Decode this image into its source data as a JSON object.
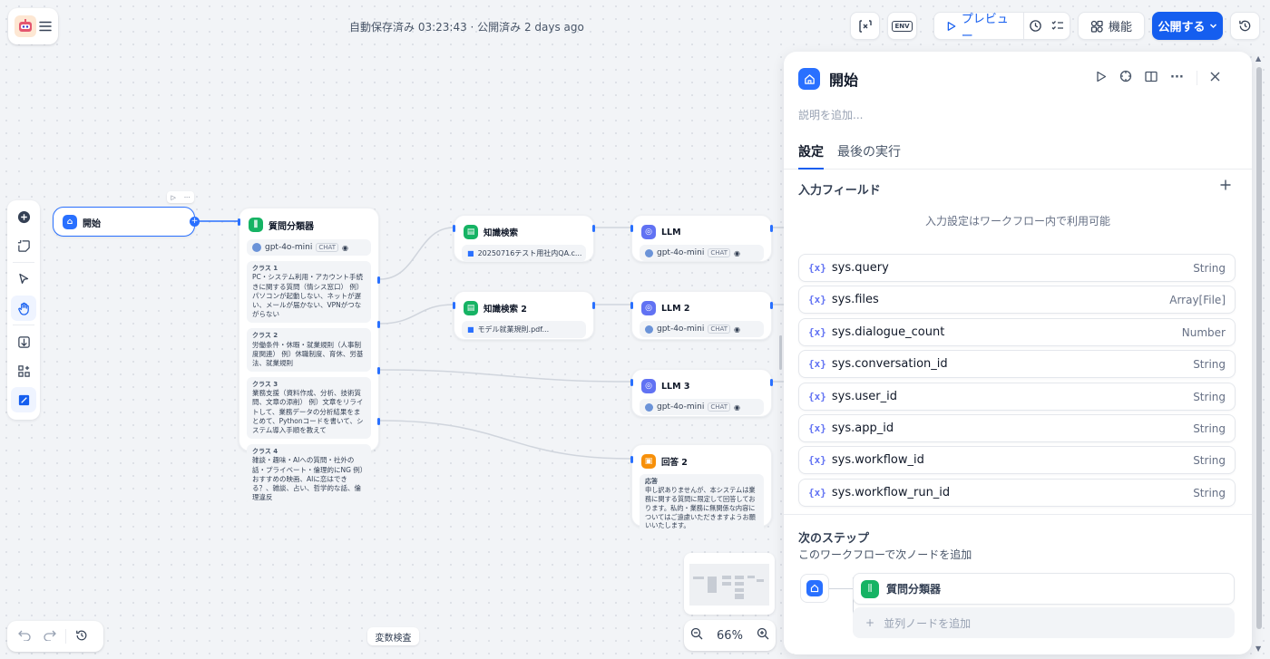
{
  "header": {
    "status_text": "自動保存済み 03:23:43 · 公開済み 2 days ago",
    "env_label": "ENV",
    "preview_label": "プレビュー",
    "features_label": "機能",
    "publish_label": "公開する"
  },
  "canvas": {
    "nodes": {
      "start": {
        "title": "開始"
      },
      "classifier": {
        "title": "質問分類器",
        "model": "gpt-4o-mini",
        "model_tag": "CHAT",
        "classes": [
          {
            "label": "クラス 1",
            "text": "PC・システム利用・アカウント手続きに関する質問（情シス窓口） 例）パソコンが起動しない、ネットが遅い、メールが届かない、VPNがつながらない"
          },
          {
            "label": "クラス 2",
            "text": "労働条件・休暇・就業規則（人事制度関連） 例）休職制度、育休、労基法、就業規則"
          },
          {
            "label": "クラス 3",
            "text": "業務支援（資料作成、分析、技術質問、文章の添削） 例）文章をリライトして、業務データの分析結果をまとめて、Pythonコードを書いて、システム導入手順を教えて"
          },
          {
            "label": "クラス 4",
            "text": "雑談・趣味・AIへの質問・社外の話・プライベート・倫理的にNG 例）おすすめの映画、AIに恋はできる？、雑談、占い、哲学的な話、倫理違反"
          }
        ]
      },
      "kb1": {
        "title": "知識検索",
        "file": "20250716テスト用社内QA.c..."
      },
      "kb2": {
        "title": "知識検索 2",
        "file": "モデル就業規則.pdf..."
      },
      "llm1": {
        "title": "LLM",
        "model": "gpt-4o-mini",
        "tag": "CHAT"
      },
      "llm2": {
        "title": "LLM 2",
        "model": "gpt-4o-mini",
        "tag": "CHAT"
      },
      "llm3": {
        "title": "LLM 3",
        "model": "gpt-4o-mini",
        "tag": "CHAT"
      },
      "answer2": {
        "title": "回答 2",
        "label": "応答",
        "text": "申し訳ありませんが、本システムは業務に関する質問に限定して回答しております。私的・業務に無関係な内容についてはご遠慮いただきますようお願いいたします。"
      }
    },
    "var_inspect_label": "変数検査",
    "zoom": "66%"
  },
  "panel": {
    "title": "開始",
    "description_placeholder": "説明を追加...",
    "tabs": [
      "設定",
      "最後の実行"
    ],
    "input_fields_label": "入力フィールド",
    "input_note": "入力設定はワークフロー内で利用可能",
    "variables": [
      {
        "name": "sys.query",
        "type": "String"
      },
      {
        "name": "sys.files",
        "type": "Array[File]"
      },
      {
        "name": "sys.dialogue_count",
        "type": "Number"
      },
      {
        "name": "sys.conversation_id",
        "type": "String"
      },
      {
        "name": "sys.user_id",
        "type": "String"
      },
      {
        "name": "sys.app_id",
        "type": "String"
      },
      {
        "name": "sys.workflow_id",
        "type": "String"
      },
      {
        "name": "sys.workflow_run_id",
        "type": "String"
      }
    ],
    "next_step_title": "次のステップ",
    "next_step_desc": "このワークフローで次ノードを追加",
    "next_node": "質問分類器",
    "add_parallel": "並列ノードを追加"
  },
  "colors": {
    "accent": "#155eef",
    "start_icon": "#2970ff",
    "classifier_icon": "#16b364",
    "llm_icon": "#6172f3",
    "answer_icon": "#f79009"
  }
}
